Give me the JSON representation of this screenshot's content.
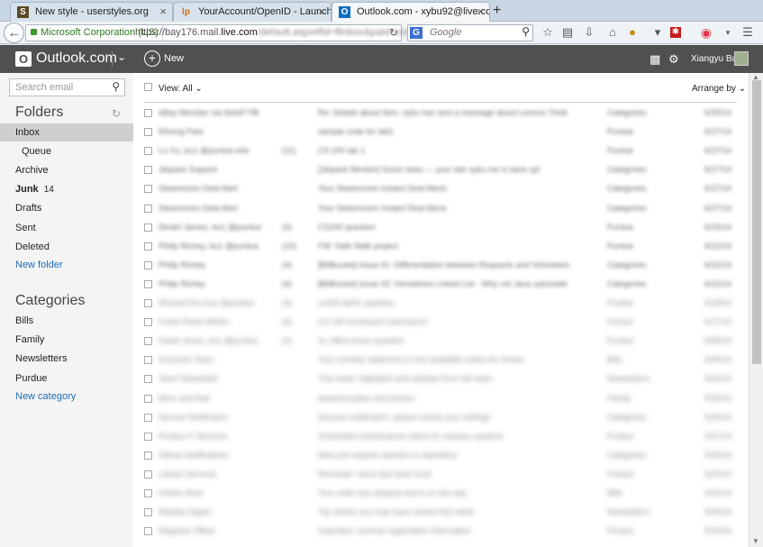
{
  "browser": {
    "tabs": [
      {
        "label": "New style - userstyles.org",
        "icon": "S"
      },
      {
        "label": "YourAccount/OpenID - Launchpa...",
        "icon": "lp"
      },
      {
        "label": "Outlook.com - xybu92@live.com",
        "icon": "O"
      }
    ],
    "new_tab_glyph": "+",
    "close_glyph": "×",
    "identity": "Microsoft Corporation (US)",
    "url_prefix": "https://bay176.mail.",
    "url_domain": "live.com",
    "url_rest": "/default.aspx#fid=flinbox&paid=config",
    "search_engine": "G",
    "search_placeholder": "Google"
  },
  "outlook": {
    "logo_letter": "O",
    "brand": "Outlook.com",
    "new_label": "New",
    "user_name": "Xiangyu Bu"
  },
  "sidebar": {
    "search_placeholder": "Search email",
    "folders_title": "Folders",
    "folders": [
      {
        "label": "Inbox"
      },
      {
        "label": "Queue"
      },
      {
        "label": "Archive"
      },
      {
        "label": "Junk",
        "count": "14"
      },
      {
        "label": "Drafts"
      },
      {
        "label": "Sent"
      },
      {
        "label": "Deleted"
      },
      {
        "label": "New folder"
      }
    ],
    "categories_title": "Categories",
    "categories": [
      {
        "label": "Bills"
      },
      {
        "label": "Family"
      },
      {
        "label": "Newsletters"
      },
      {
        "label": "Purdue"
      },
      {
        "label": "New category"
      }
    ]
  },
  "list": {
    "view_label": "View: All",
    "arrange_label": "Arrange by",
    "messages": [
      {
        "from": "eBay Member via IbidsFYIB",
        "subject": "Re: Details about item: xybu has sent a message about Lenovo Think",
        "category": "Categories",
        "date": "6/29/14"
      },
      {
        "from": "Ethong Park",
        "subject": "sample code for lab2",
        "category": "Purdue",
        "date": "6/27/14"
      },
      {
        "from": "Lu Xu, bu1 @purdue.edu",
        "count": "(11)",
        "subject": "CS 240 lab 1",
        "category": "Purdue",
        "date": "6/27/14"
      },
      {
        "from": "Jetpack Support",
        "subject": "[Jetpack Monitor] Good news — your site xybu.me is back up!",
        "category": "Categories",
        "date": "6/27/14"
      },
      {
        "from": "Steamroom Deal Alert",
        "subject": "Your Steamroom Instant Deal Alerts",
        "category": "Categories",
        "date": "6/27/14"
      },
      {
        "from": "Steamroom Deal Alert",
        "subject": "Your Steamroom Instant Deal Alerts",
        "category": "Categories",
        "date": "6/27/14"
      },
      {
        "from": "Dimitri James, bu1 @purdue",
        "count": "(4)",
        "subject": "CS240 question",
        "category": "Purdue",
        "date": "6/24/14"
      },
      {
        "from": "Philip Richey, bu1 @purdue",
        "count": "(10)",
        "subject": "FW: Safe Walk project",
        "category": "Purdue",
        "date": "6/22/14"
      },
      {
        "from": "Philip Richey",
        "count": "(4)",
        "subject": "[BitBucket] Issue #1: Differentiation between Requests and Volunteers",
        "category": "Categories",
        "date": "6/22/14"
      },
      {
        "from": "Philip Richey",
        "count": "(4)",
        "subject": "[BitBucket] Issue #2: Homebrew Linked List - Why not Java xybu/safe",
        "category": "Categories",
        "date": "6/22/14"
      },
      {
        "from": "Richard Kim bu1 @purdue",
        "count": "(4)",
        "subject": "cs240 lab01 question",
        "category": "Purdue",
        "date": "6/18/14"
      },
      {
        "from": "Frank Porter Mellon",
        "count": "(4)",
        "subject": "CS 240 homework submission",
        "category": "Purdue",
        "date": "6/17/14"
      },
      {
        "from": "Sarah Jones, bu1 @purdue",
        "count": "(4)",
        "subject": "re: office hours question",
        "category": "Purdue",
        "date": "6/09/14"
      },
      {
        "from": "Accounts Team",
        "subject": "Your monthly statement is now available online for review",
        "category": "Bills",
        "date": "6/05/14"
      },
      {
        "from": "Team Newsletter",
        "subject": "This week: highlights and updates from the team",
        "category": "Newsletters",
        "date": "6/03/14"
      },
      {
        "from": "Mom and Dad",
        "subject": "weekend plans and photos",
        "category": "Family",
        "date": "5/30/14"
      },
      {
        "from": "Service Notification",
        "subject": "Account notification: please review your settings",
        "category": "Categories",
        "date": "5/29/14"
      },
      {
        "from": "Purdue IT Services",
        "subject": "Scheduled maintenance notice for campus systems",
        "category": "Purdue",
        "date": "5/27/14"
      },
      {
        "from": "Github Notifications",
        "subject": "New pull request opened on repository",
        "category": "Categories",
        "date": "5/26/14"
      },
      {
        "from": "Library Services",
        "subject": "Reminder: items due back soon",
        "category": "Purdue",
        "date": "5/23/14"
      },
      {
        "from": "Online Store",
        "subject": "Your order has shipped and is on the way",
        "category": "Bills",
        "date": "5/22/14"
      },
      {
        "from": "Weekly Digest",
        "subject": "Top stories you may have missed this week",
        "category": "Newsletters",
        "date": "5/20/14"
      },
      {
        "from": "Registrar Office",
        "subject": "Important: summer registration information",
        "category": "Purdue",
        "date": "5/19/14"
      }
    ]
  }
}
